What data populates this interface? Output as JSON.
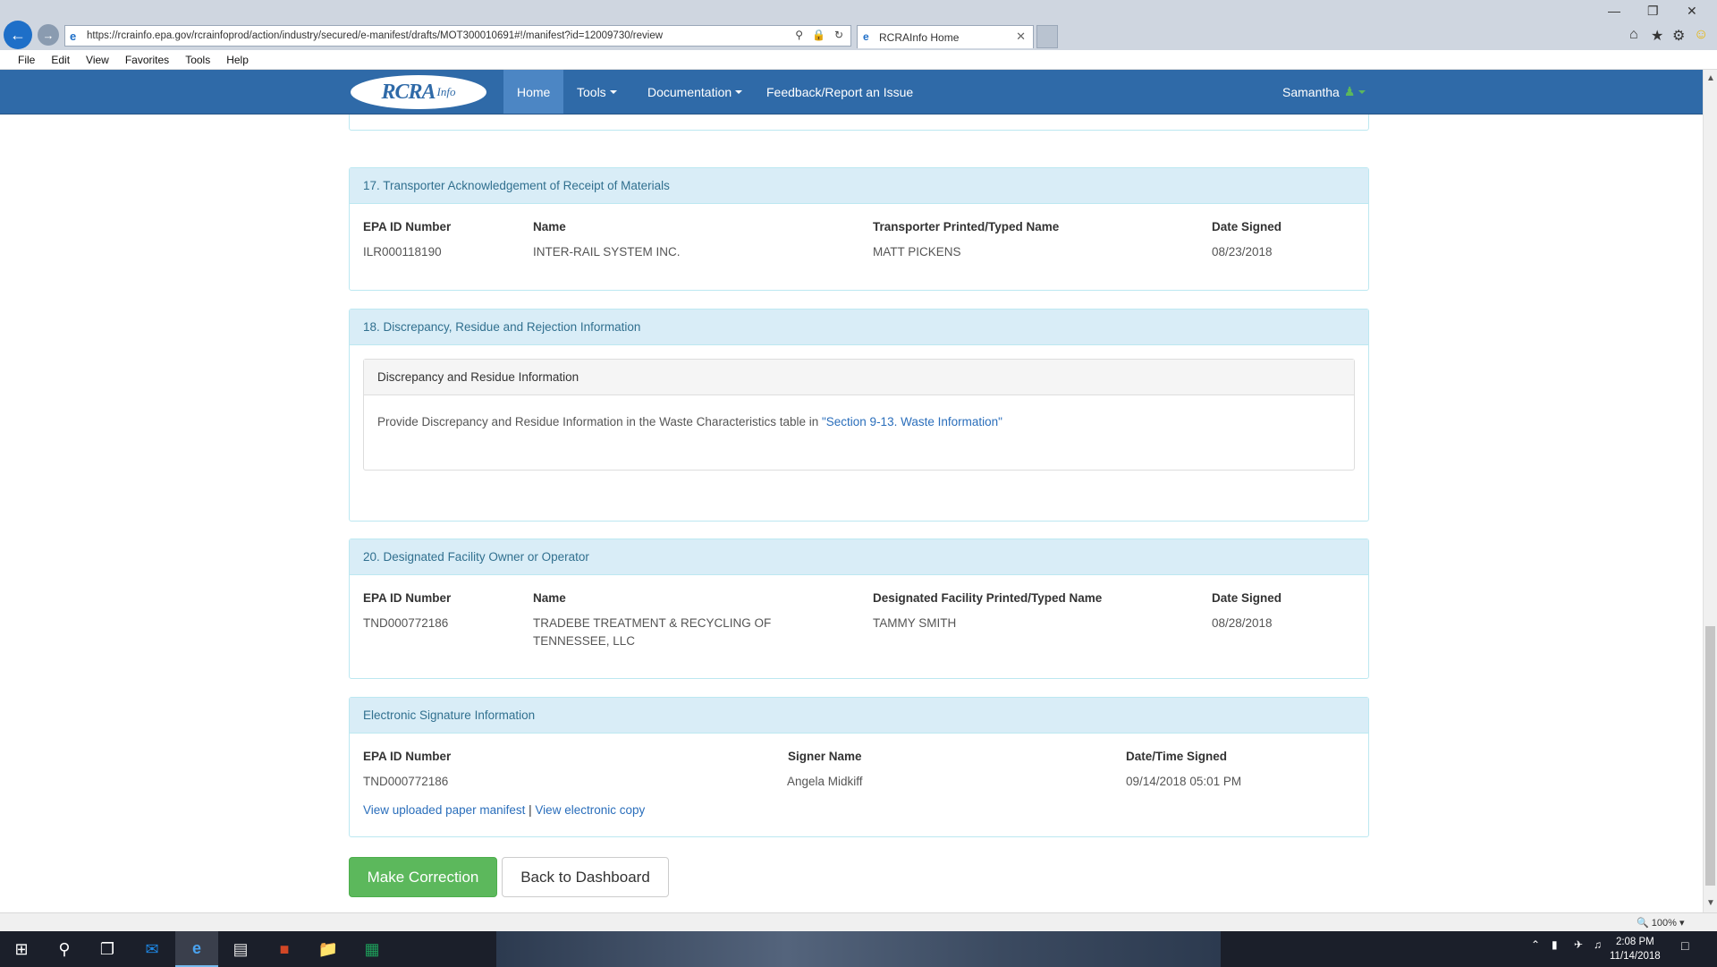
{
  "browser": {
    "url": "https://rcrainfo.epa.gov/rcrainfoprod/action/industry/secured/e-manifest/drafts/MOT300010691#!/manifest?id=12009730/review",
    "tab_title": "RCRAInfo Home",
    "menu": [
      "File",
      "Edit",
      "View",
      "Favorites",
      "Tools",
      "Help"
    ],
    "zoom": "100%"
  },
  "site": {
    "logo_text": "RCRA",
    "logo_suffix": "Info",
    "nav": {
      "home": "Home",
      "tools": "Tools",
      "documentation": "Documentation",
      "feedback": "Feedback/Report an Issue"
    },
    "user": "Samantha"
  },
  "section17": {
    "title": "17. Transporter Acknowledgement of Receipt of Materials",
    "headers": {
      "epa_id": "EPA ID Number",
      "name": "Name",
      "printed_name": "Transporter Printed/Typed Name",
      "date": "Date Signed"
    },
    "values": {
      "epa_id": "ILR000118190",
      "name": "INTER-RAIL SYSTEM INC.",
      "printed_name": "MATT PICKENS",
      "date": "08/23/2018"
    }
  },
  "section18": {
    "title": "18. Discrepancy, Residue and Rejection Information",
    "inner_title": "Discrepancy and Residue Information",
    "text": "Provide Discrepancy and Residue Information in the Waste Characteristics table in ",
    "link": "\"Section 9-13. Waste Information\""
  },
  "section20": {
    "title": "20. Designated Facility Owner or Operator",
    "headers": {
      "epa_id": "EPA ID Number",
      "name": "Name",
      "printed_name": "Designated Facility Printed/Typed Name",
      "date": "Date Signed"
    },
    "values": {
      "epa_id": "TND000772186",
      "name": "TRADEBE TREATMENT & RECYCLING OF TENNESSEE, LLC",
      "printed_name": "TAMMY SMITH",
      "date": "08/28/2018"
    }
  },
  "esig": {
    "title": "Electronic Signature Information",
    "headers": {
      "epa_id": "EPA ID Number",
      "signer": "Signer Name",
      "datetime": "Date/Time Signed"
    },
    "values": {
      "epa_id": "TND000772186",
      "signer": "Angela Midkiff",
      "datetime": "09/14/2018 05:01 PM"
    },
    "link_paper": "View uploaded paper manifest",
    "separator": "|",
    "link_electronic": "View electronic copy"
  },
  "actions": {
    "correction": "Make Correction",
    "dashboard": "Back to Dashboard"
  },
  "taskbar": {
    "time": "2:08 PM",
    "date": "11/14/2018"
  }
}
